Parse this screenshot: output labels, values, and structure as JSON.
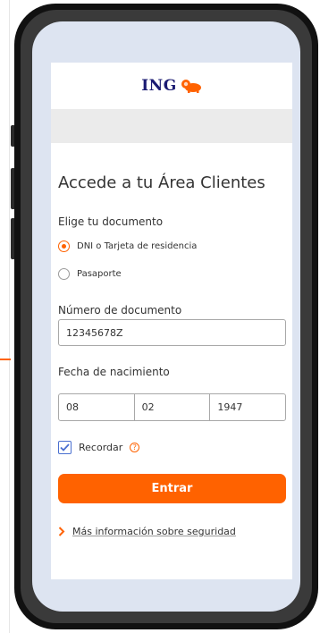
{
  "brand": {
    "name": "ING",
    "accent": "#ff6200",
    "navy": "#1b1b72"
  },
  "form": {
    "title": "Accede a tu Área Clientes",
    "doc_type_label": "Elige tu documento",
    "options": [
      {
        "label": "DNI o Tarjeta de residencia",
        "selected": true
      },
      {
        "label": "Pasaporte",
        "selected": false
      }
    ],
    "doc_number_label": "Número de documento",
    "doc_number_value": "12345678Z",
    "birth_label": "Fecha de nacimiento",
    "birth": {
      "day": "08",
      "month": "02",
      "year": "1947"
    },
    "remember_label": "Recordar",
    "remember_checked": true,
    "help_icon": "?",
    "submit_label": "Entrar",
    "security_link": "Más información sobre seguridad"
  }
}
